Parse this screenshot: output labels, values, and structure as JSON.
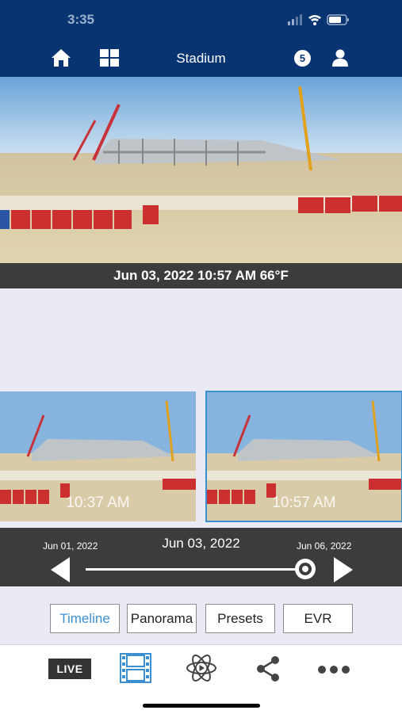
{
  "status": {
    "time": "3:35"
  },
  "nav": {
    "title": "Stadium",
    "notification_count": "5"
  },
  "hero": {
    "caption": "Jun 03, 2022 10:57 AM 66°F"
  },
  "thumbnails": [
    {
      "time": "10:37 AM",
      "selected": false
    },
    {
      "time": "10:57 AM",
      "selected": true
    }
  ],
  "timeline": {
    "current_date": "Jun 03, 2022",
    "start_date": "Jun 01, 2022",
    "end_date": "Jun 06, 2022",
    "position": 1.0
  },
  "tabs": [
    {
      "label": "Timeline",
      "active": true
    },
    {
      "label": "Panorama",
      "active": false
    },
    {
      "label": "Presets",
      "active": false
    },
    {
      "label": "EVR",
      "active": false
    }
  ],
  "bottom_nav": {
    "live_label": "LIVE"
  },
  "colors": {
    "header_bg": "#083572",
    "dark_bar": "#3c3c3c",
    "accent": "#3b8fd1",
    "page_bg": "#e9eaf4"
  }
}
